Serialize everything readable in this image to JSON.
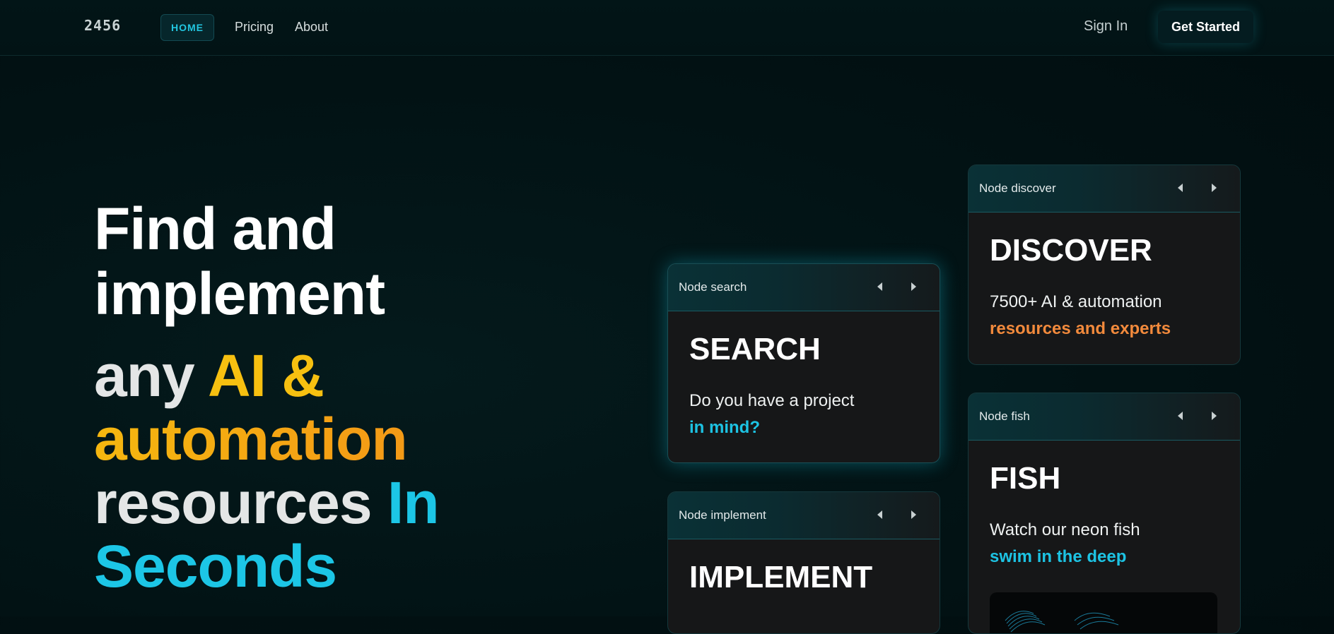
{
  "nav": {
    "logo": "2456",
    "items": [
      "HOME",
      "Pricing",
      "About"
    ],
    "sign_in": "Sign In",
    "get_started": "Get Started"
  },
  "hero": {
    "line1": "Find and",
    "line2": "implement",
    "line3a": "any ",
    "line3b": "AI &",
    "line4": "automation",
    "line5a": "resources ",
    "line5b": "In",
    "line6": "Seconds"
  },
  "cards": [
    {
      "header": "Node search",
      "title": "SEARCH",
      "text": "Do you have a project",
      "accent": "in mind?"
    },
    {
      "header": "Node implement",
      "title": "IMPLEMENT"
    },
    {
      "header": "Node discover",
      "title": "DISCOVER",
      "text": "7500+ AI & automation",
      "accent": "resources and experts"
    },
    {
      "header": "Node fish",
      "title": "FISH",
      "text": "Watch our neon fish",
      "accent": "swim in the deep"
    }
  ],
  "colors": {
    "accent_cyan": "#1cc6e6",
    "accent_yellow": "#f7c010",
    "accent_orange": "#f28a3c",
    "background": "#021214"
  },
  "icons": [
    "arrow-left-icon",
    "arrow-right-icon"
  ]
}
